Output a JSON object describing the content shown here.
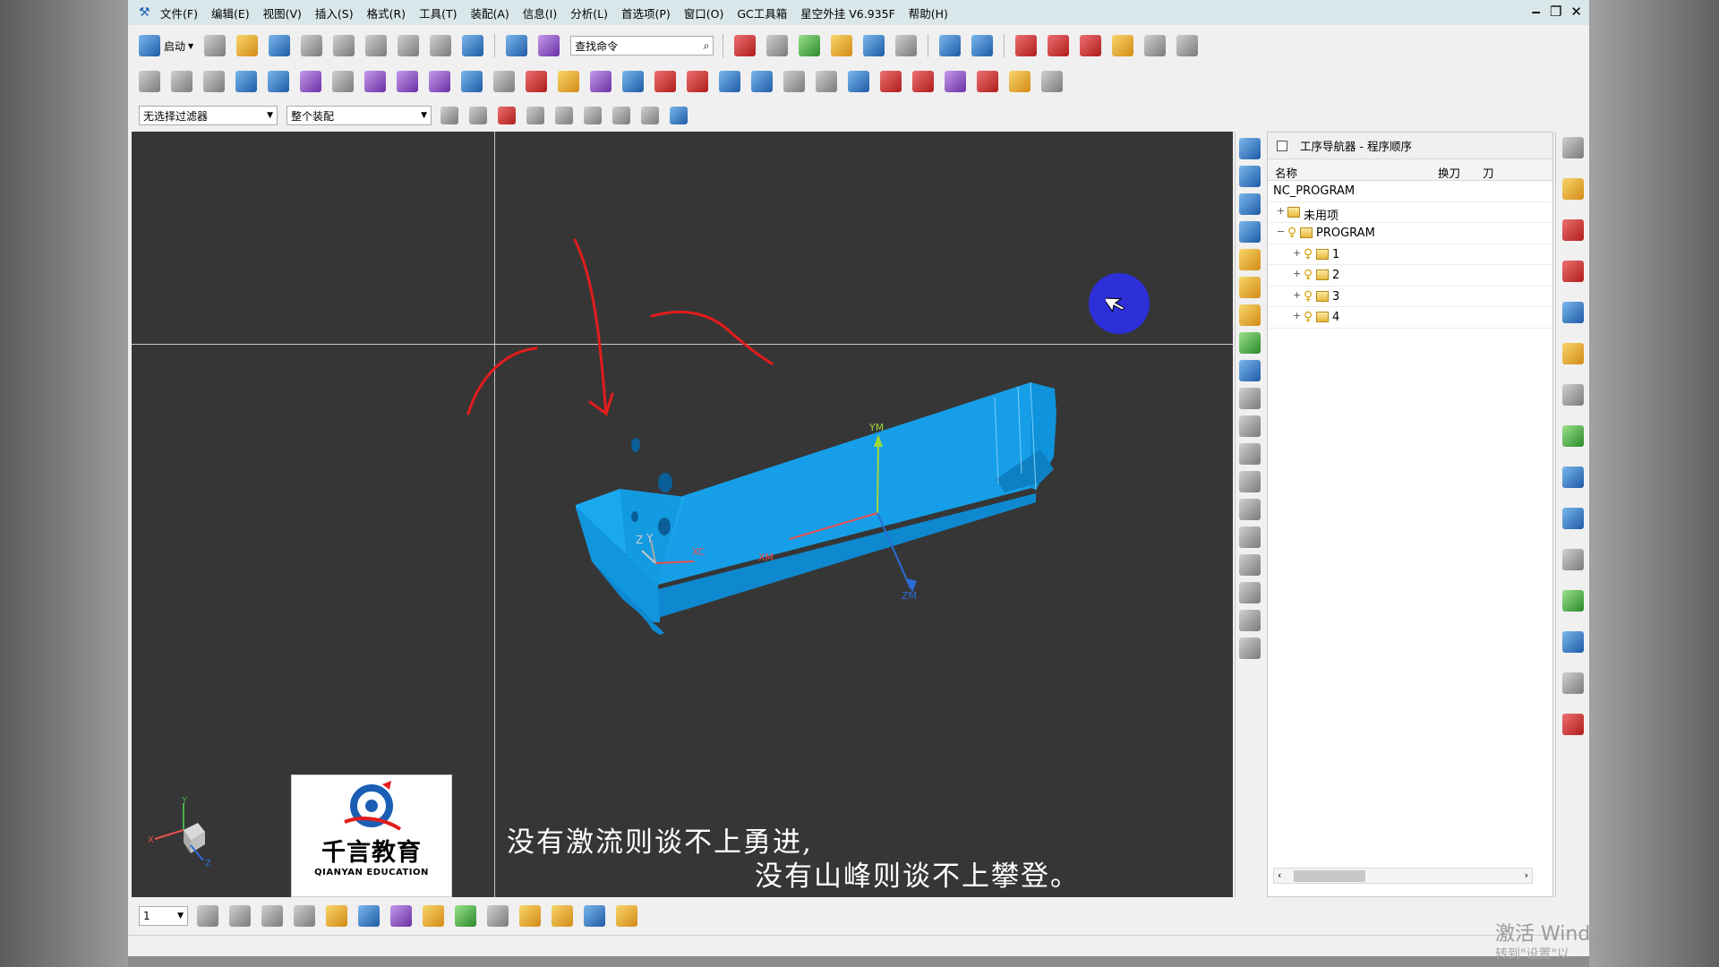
{
  "app": {
    "menus": [
      "文件(F)",
      "编辑(E)",
      "视图(V)",
      "插入(S)",
      "格式(R)",
      "工具(T)",
      "装配(A)",
      "信息(I)",
      "分析(L)",
      "首选项(P)",
      "窗口(O)",
      "GC工具箱",
      "星空外挂 V6.935F",
      "帮助(H)"
    ],
    "window_controls": [
      "‒",
      "❐",
      "✕"
    ]
  },
  "toolbar": {
    "launch_label": "启动",
    "find_command_value": "查找命令",
    "filter1_value": "无选择过滤器",
    "filter2_value": "整个装配"
  },
  "viewport": {
    "quote_line1": "没有激流则谈不上勇进,",
    "quote_line2": "没有山峰则谈不上攀登。",
    "model_labels": {
      "ym": "YM",
      "xm": "XM",
      "zm": "ZM",
      "zc": "Z",
      "yc": "Y",
      "xc": "XC"
    },
    "triad_labels": {
      "x": "X",
      "y": "Y",
      "z": "Z"
    },
    "colors": {
      "part": "#169fe8",
      "annotation": "#e31c1c",
      "cursor_dot": "#2d2fd8",
      "background": "#363636"
    }
  },
  "logo": {
    "chinese": "千言教育",
    "english": "QIANYAN EDUCATION"
  },
  "navigator": {
    "title": "工序导航器 - 程序顺序",
    "columns": [
      "名称",
      "换刀",
      "刀"
    ],
    "root": "NC_PROGRAM",
    "nodes": [
      {
        "label": "未用项",
        "expander": "+"
      },
      {
        "label": "PROGRAM",
        "expander": "−"
      },
      {
        "label": "1",
        "expander": "+"
      },
      {
        "label": "2",
        "expander": "+"
      },
      {
        "label": "3",
        "expander": "+"
      },
      {
        "label": "4",
        "expander": "+"
      }
    ]
  },
  "bottom": {
    "layer_value": "1"
  },
  "watermark": {
    "line1": "激活 Wind",
    "line2": "转到\"设置\"以"
  }
}
